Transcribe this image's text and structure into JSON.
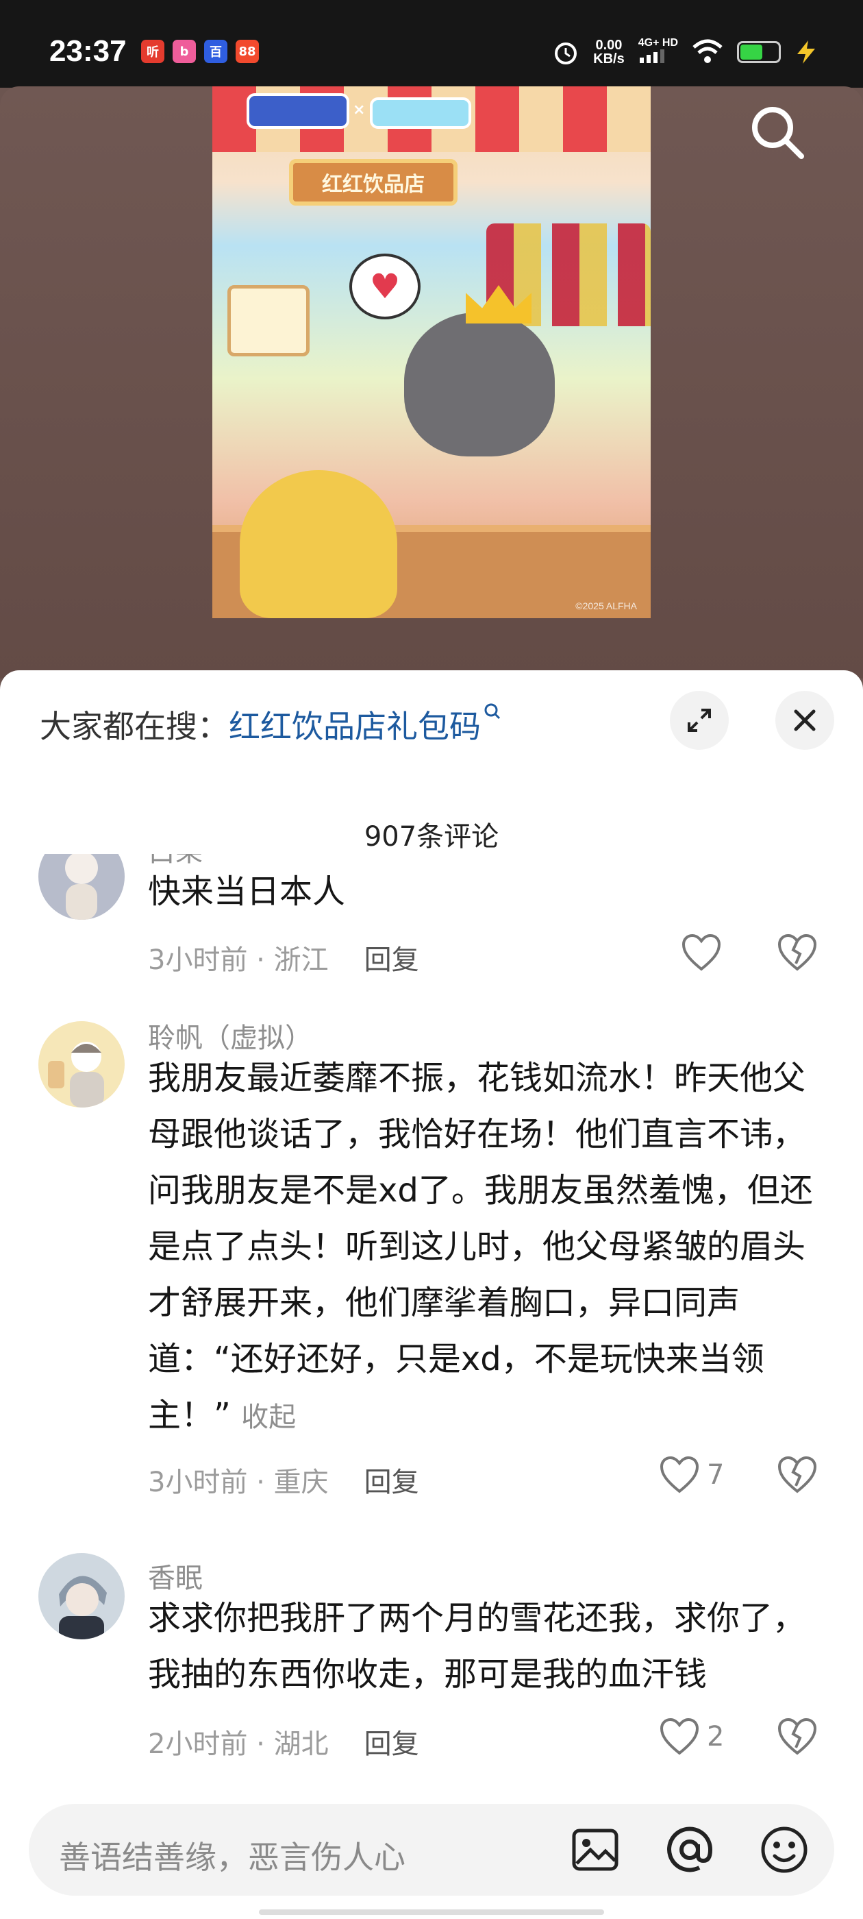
{
  "status_bar": {
    "time": "23:37",
    "apps": [
      {
        "name": "ting-app-icon",
        "glyph": "听",
        "color": "#e43b2e"
      },
      {
        "name": "bilibili-app-icon",
        "glyph": "b",
        "color": "#ef5d9a"
      },
      {
        "name": "baidu-app-icon",
        "glyph": "百",
        "color": "#2f5ee0"
      },
      {
        "name": "podcast-app-icon",
        "glyph": "88",
        "color": "#f24a2e"
      }
    ],
    "net_speed_value": "0.00",
    "net_speed_unit": "KB/s",
    "network": "4G+ HD",
    "battery_level": 0.55
  },
  "poster": {
    "shop_sign": "红红饮品店",
    "copyright": "©2025 ALFHA"
  },
  "sheet": {
    "suggest_prefix": "大家都在搜：",
    "suggest_term": "红红饮品店礼包码",
    "comment_count": "907条评论"
  },
  "comments": [
    {
      "name": "白果",
      "text": "快来当日本人",
      "time": "3小时前",
      "location": "浙江",
      "reply": "回复",
      "likes": ""
    },
    {
      "name": "聆帆（虚拟）",
      "text": "我朋友最近萎靡不振，花钱如流水！昨天他父母跟他谈话了，我恰好在场！他们直言不讳，问我朋友是不是xd了。我朋友虽然羞愧，但还是点了点头！听到这儿时，他父母紧皱的眉头才舒展开来，他们摩挲着胸口，异口同声道：“还好还好，只是xd，不是玩快来当领主！”",
      "collapse": "收起",
      "time": "3小时前",
      "location": "重庆",
      "reply": "回复",
      "likes": "7"
    },
    {
      "name": "香眠",
      "text": "求求你把我肝了两个月的雪花还我，求你了，我抽的东西你收走，那可是我的血汗钱",
      "time": "2小时前",
      "location": "湖北",
      "reply": "回复",
      "likes": "2"
    }
  ],
  "input": {
    "placeholder": "善语结善缘，恶言伤人心"
  }
}
